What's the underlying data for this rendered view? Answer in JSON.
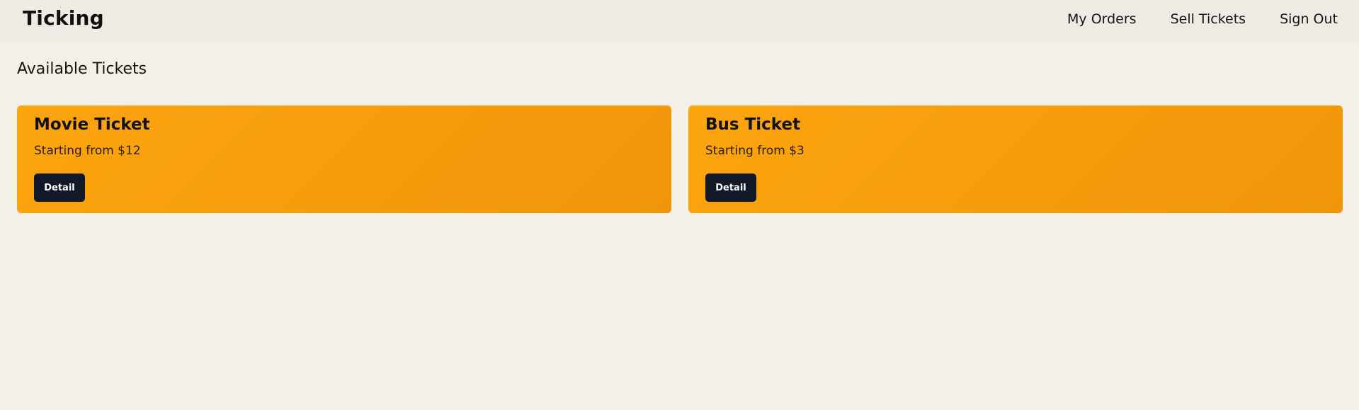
{
  "navbar": {
    "brand": "Ticking",
    "links": [
      "My Orders",
      "Sell Tickets",
      "Sign Out"
    ]
  },
  "main": {
    "title": "Available Tickets",
    "tickets": [
      {
        "name": "Movie Ticket",
        "price_text": "Starting from $12",
        "button_label": "Detail"
      },
      {
        "name": "Bus Ticket",
        "price_text": "Starting from $3",
        "button_label": "Detail"
      }
    ]
  },
  "colors": {
    "background": "#f4f0e8",
    "navbar": "#efeae3",
    "card_gradient_start": "#fba50f",
    "card_gradient_end": "#f0950a",
    "button": "#111827"
  }
}
